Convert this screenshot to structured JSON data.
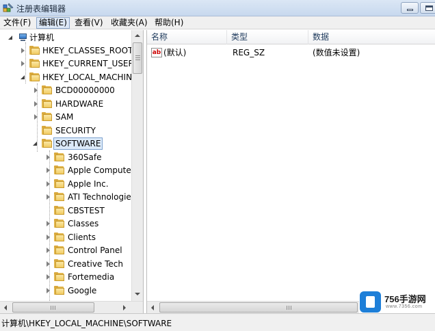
{
  "window": {
    "title": "注册表编辑器"
  },
  "menu": [
    {
      "label": "文件(F)"
    },
    {
      "label": "编辑(E)"
    },
    {
      "label": "查看(V)"
    },
    {
      "label": "收藏夹(A)"
    },
    {
      "label": "帮助(H)"
    }
  ],
  "tree": {
    "root": "计算机",
    "hives": [
      "HKEY_CLASSES_ROOT",
      "HKEY_CURRENT_USER",
      "HKEY_LOCAL_MACHINE"
    ],
    "hklm_children": [
      "BCD00000000",
      "HARDWARE",
      "SAM",
      "SECURITY",
      "SOFTWARE"
    ],
    "software_children": [
      "360Safe",
      "Apple Computer",
      "Apple Inc.",
      "ATI Technologie",
      "CBSTEST",
      "Classes",
      "Clients",
      "Control Panel",
      "Creative Tech",
      "Fortemedia",
      "Google"
    ]
  },
  "list": {
    "columns": [
      "名称",
      "类型",
      "数据"
    ],
    "rows": [
      {
        "icon": "string-value-icon",
        "icon_text": "ab",
        "name": "(默认)",
        "type": "REG_SZ",
        "data": "(数值未设置)"
      }
    ]
  },
  "status": {
    "path": "计算机\\HKEY_LOCAL_MACHINE\\SOFTWARE"
  },
  "watermark": {
    "brand": "756手游网",
    "url": "www.7356.com"
  },
  "colors": {
    "selection": "#dceaf9",
    "folder": "#f1cc63",
    "watermark": "#1e7fd8"
  }
}
